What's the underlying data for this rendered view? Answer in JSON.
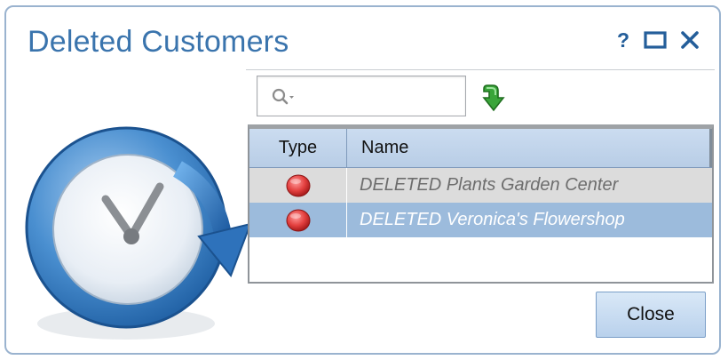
{
  "dialog": {
    "title": "Deleted Customers",
    "help_label": "?",
    "accent_color": "#3a74ad"
  },
  "search": {
    "value": "",
    "placeholder": ""
  },
  "table": {
    "headers": {
      "type": "Type",
      "name": "Name"
    },
    "rows": [
      {
        "type_icon": "red-circle-icon",
        "name": "DELETED Plants Garden Center",
        "selected": false
      },
      {
        "type_icon": "red-circle-icon",
        "name": "DELETED Veronica's Flowershop",
        "selected": true
      }
    ],
    "selected_row_color": "#9cbbdc"
  },
  "buttons": {
    "close_label": "Close"
  },
  "icons": {
    "title_bar": [
      "help-icon",
      "maximize-icon",
      "close-icon"
    ],
    "search": "search-icon",
    "refresh": "refresh-icon",
    "illustration": "clock-history-icon"
  }
}
